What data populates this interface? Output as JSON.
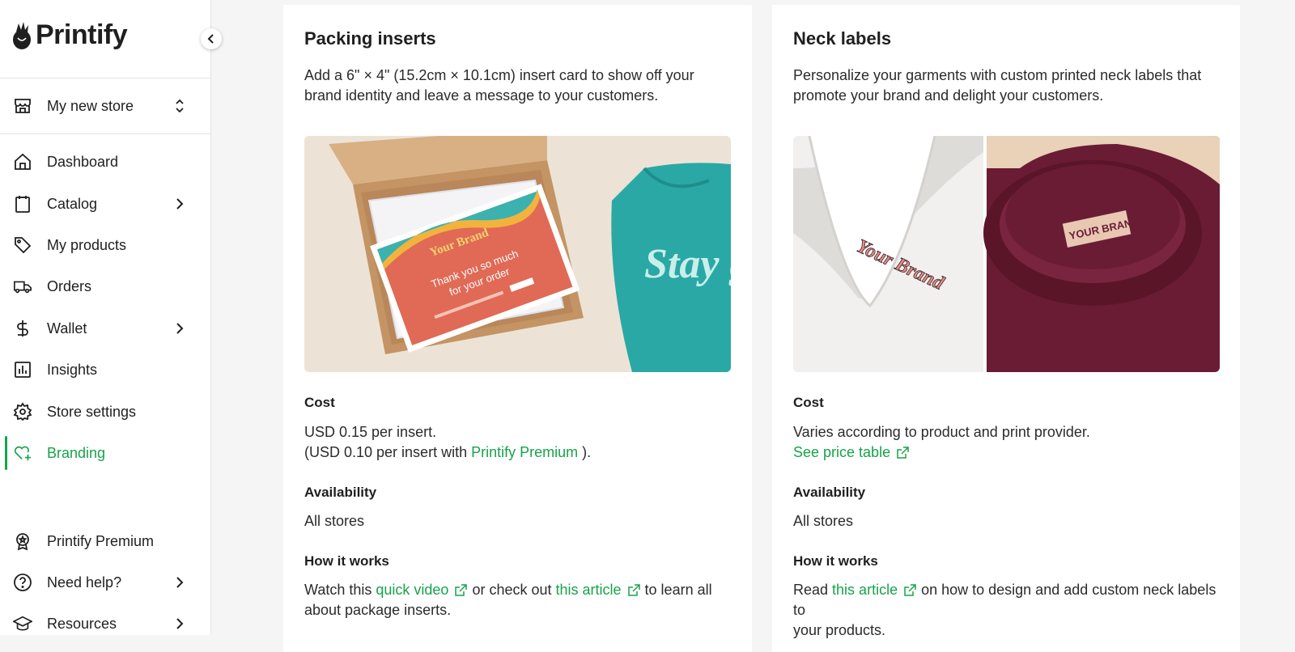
{
  "brand": {
    "name": "Printify",
    "accent_color": "#17a34a"
  },
  "sidebar": {
    "store": {
      "label": "My new store",
      "icon": "store-icon"
    },
    "items": [
      {
        "label": "Dashboard",
        "icon": "home-icon"
      },
      {
        "label": "Catalog",
        "icon": "catalog-icon",
        "has_submenu": true
      },
      {
        "label": "My products",
        "icon": "tag-icon"
      },
      {
        "label": "Orders",
        "icon": "truck-icon"
      },
      {
        "label": "Wallet",
        "icon": "dollar-icon",
        "has_submenu": true
      },
      {
        "label": "Insights",
        "icon": "chart-icon"
      },
      {
        "label": "Store settings",
        "icon": "gear-icon"
      },
      {
        "label": "Branding",
        "icon": "heart-plus-icon",
        "active": true
      }
    ],
    "bottom_items": [
      {
        "label": "Printify Premium",
        "icon": "badge-icon"
      },
      {
        "label": "Need help?",
        "icon": "help-icon",
        "has_submenu": true
      },
      {
        "label": "Resources",
        "icon": "graduation-cap-icon",
        "has_submenu": true
      }
    ]
  },
  "packing_inserts": {
    "title": "Packing inserts",
    "description": "Add a 6\" × 4\" (15.2cm × 10.1cm) insert card to show off your brand identity and leave a message to your customers.",
    "image": {
      "card_brand": "Your Brand",
      "card_line1": "Thank you so much",
      "card_line2": "for your order",
      "shirt_text": "Stay groo"
    },
    "cost_label": "Cost",
    "cost_line1": "USD 0.15 per insert.",
    "cost_line2_prefix": "(USD 0.10 per insert with",
    "cost_line2_link": "Printify Premium",
    "cost_line2_suffix": ").",
    "availability_label": "Availability",
    "availability_value": "All stores",
    "how_label": "How it works",
    "how_prefix": "Watch this",
    "how_link1": "quick video",
    "how_middle": "or check out",
    "how_link2": "this article",
    "how_suffix_1": "to learn all",
    "how_suffix_2": "about package inserts."
  },
  "neck_labels": {
    "title": "Neck labels",
    "description": "Personalize your garments with custom printed neck labels that promote your brand and delight your customers.",
    "image": {
      "label_left": "Your Brand",
      "label_right": "YOUR BRAND"
    },
    "cost_label": "Cost",
    "cost_line1": "Varies according to product and print provider.",
    "cost_link": "See price table",
    "availability_label": "Availability",
    "availability_value": "All stores",
    "how_label": "How it works",
    "how_prefix": "Read",
    "how_link": "this article",
    "how_suffix_1": "on how to design and add custom neck labels to",
    "how_suffix_2": "your products."
  }
}
